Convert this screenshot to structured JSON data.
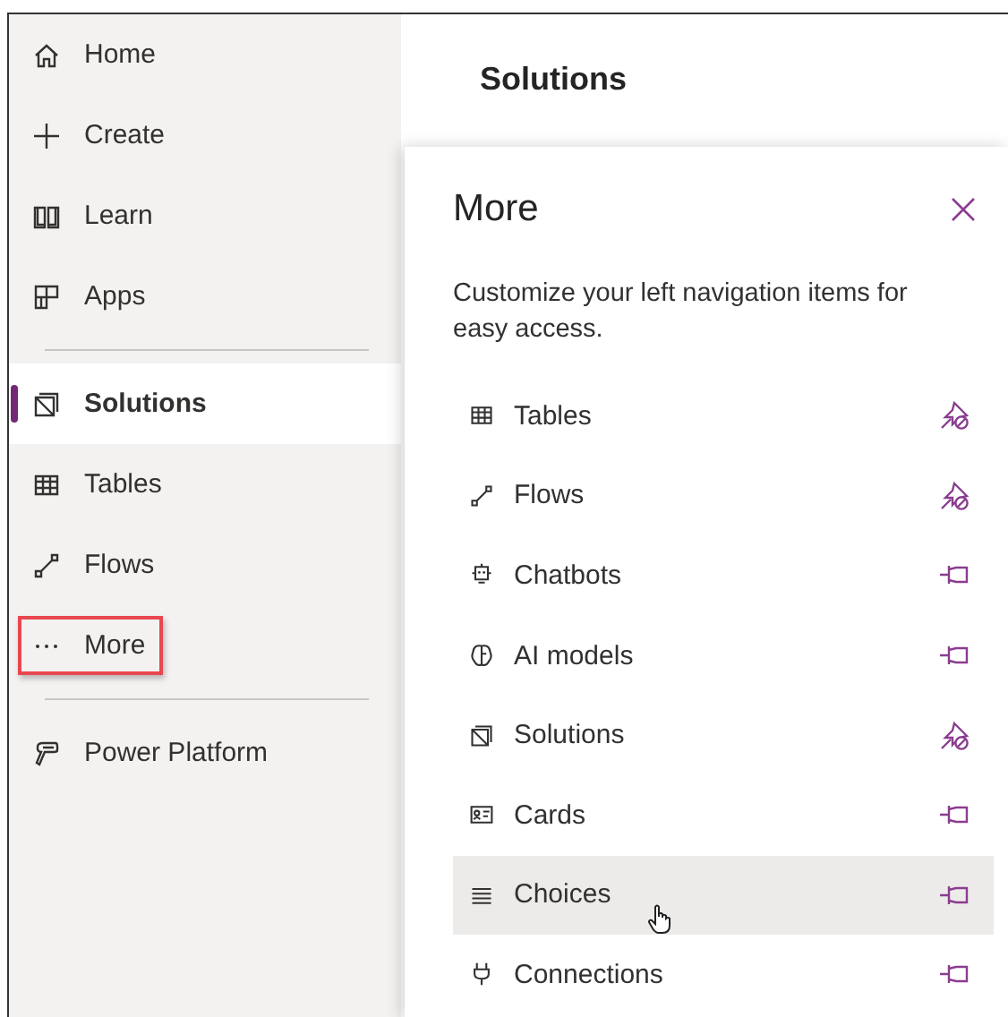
{
  "sidebar": {
    "items": [
      {
        "kind": "home",
        "label": "Home",
        "selected": false,
        "highlighted": false
      },
      {
        "kind": "plus",
        "label": "Create",
        "selected": false,
        "highlighted": false
      },
      {
        "kind": "book",
        "label": "Learn",
        "selected": false,
        "highlighted": false
      },
      {
        "kind": "apps",
        "label": "Apps",
        "selected": false,
        "highlighted": false
      },
      {
        "kind": "divider"
      },
      {
        "kind": "solution",
        "label": "Solutions",
        "selected": true,
        "highlighted": false
      },
      {
        "kind": "table",
        "label": "Tables",
        "selected": false,
        "highlighted": false
      },
      {
        "kind": "flow",
        "label": "Flows",
        "selected": false,
        "highlighted": false
      },
      {
        "kind": "dots",
        "label": "More",
        "selected": false,
        "highlighted": true
      },
      {
        "kind": "divider"
      },
      {
        "kind": "platform",
        "label": "Power Platform",
        "selected": false,
        "highlighted": false
      }
    ]
  },
  "main": {
    "title": "Solutions"
  },
  "panel": {
    "title": "More",
    "description": "Customize your left navigation items for easy access.",
    "items": [
      {
        "kind": "table",
        "label": "Tables",
        "pinned": true,
        "hovered": false
      },
      {
        "kind": "flow",
        "label": "Flows",
        "pinned": true,
        "hovered": false
      },
      {
        "kind": "bot",
        "label": "Chatbots",
        "pinned": false,
        "hovered": false
      },
      {
        "kind": "brain",
        "label": "AI models",
        "pinned": false,
        "hovered": false
      },
      {
        "kind": "solution",
        "label": "Solutions",
        "pinned": true,
        "hovered": false
      },
      {
        "kind": "card",
        "label": "Cards",
        "pinned": false,
        "hovered": false
      },
      {
        "kind": "list",
        "label": "Choices",
        "pinned": false,
        "hovered": true
      },
      {
        "kind": "plug",
        "label": "Connections",
        "pinned": false,
        "hovered": false
      }
    ]
  }
}
